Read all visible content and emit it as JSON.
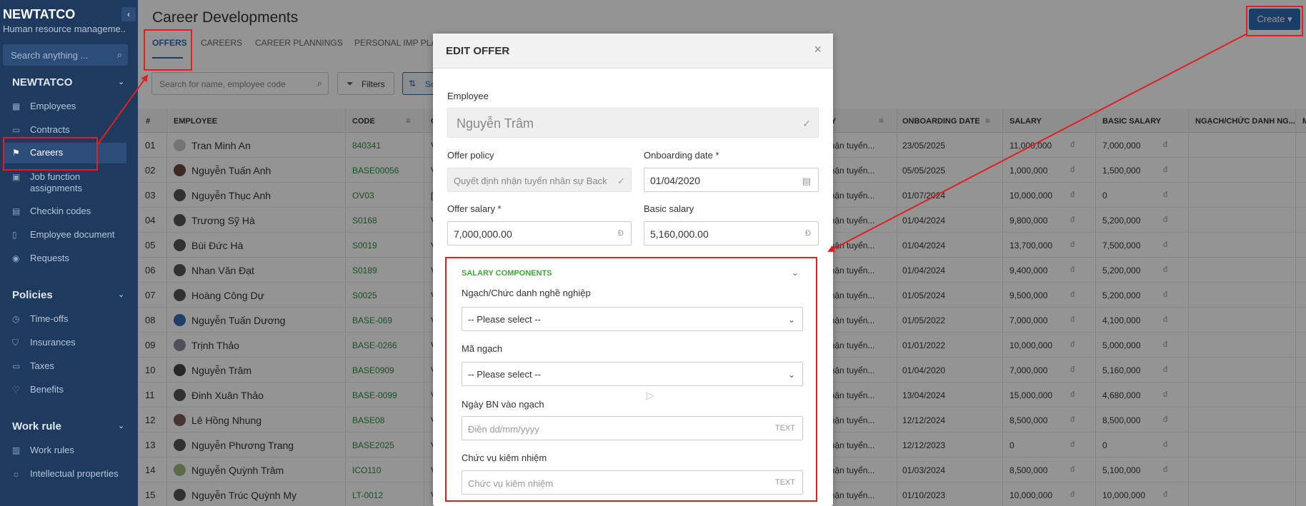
{
  "sidebar": {
    "brand": "NEWTATCO",
    "subtitle": "Human resource manageme...",
    "search_placeholder": "Search anything ...",
    "groups": [
      {
        "label": "NEWTATCO"
      },
      {
        "label": "Policies"
      },
      {
        "label": "Work rule"
      }
    ],
    "items": [
      {
        "label": "Employees",
        "icon": "grid-icon"
      },
      {
        "label": "Contracts",
        "icon": "document-icon"
      },
      {
        "label": "Careers",
        "icon": "flag-icon"
      },
      {
        "label": "Job function assignments",
        "icon": "image-icon"
      },
      {
        "label": "Checkin codes",
        "icon": "calendar-icon"
      },
      {
        "label": "Employee document",
        "icon": "file-icon"
      },
      {
        "label": "Requests",
        "icon": "signal-icon"
      },
      {
        "label": "Time-offs",
        "icon": "clock-icon"
      },
      {
        "label": "Insurances",
        "icon": "shield-icon"
      },
      {
        "label": "Taxes",
        "icon": "money-icon"
      },
      {
        "label": "Benefits",
        "icon": "heart-icon"
      },
      {
        "label": "Work rules",
        "icon": "book-icon"
      },
      {
        "label": "Intellectual properties",
        "icon": "bulb-icon"
      }
    ]
  },
  "header": {
    "title": "Career Developments",
    "create_label": "Create",
    "tabs": [
      "OFFERS",
      "CAREERS",
      "CAREER PLANNINGS",
      "PERSONAL IMP PLA"
    ]
  },
  "toolbar": {
    "search_placeholder": "Search for name, employee code",
    "filters_label": "Filters",
    "sort_label": "So"
  },
  "table": {
    "columns": [
      "#",
      "EMPLOYEE",
      "CODE",
      "C",
      "CY",
      "ONBOARDING DATE",
      "SALARY",
      "BASIC SALARY",
      "NGẠCH/CHỨC DANH NG...",
      "M"
    ],
    "currency": "đ",
    "rows": [
      {
        "num": "01",
        "name": "Tran Minh An",
        "code": "840341",
        "c": "V",
        "policy": "nhận tuyển...",
        "date": "23/05/2025",
        "salary": "11,000,000",
        "basic": "7,000,000"
      },
      {
        "num": "02",
        "name": "Nguyễn Tuấn Anh",
        "code": "BASE00056",
        "c": "V",
        "policy": "nhận tuyển...",
        "date": "05/05/2025",
        "salary": "1,000,000",
        "basic": "1,500,000"
      },
      {
        "num": "03",
        "name": "Nguyễn Thục Anh",
        "code": "OV03",
        "c": "[",
        "policy": "nhận tuyển...",
        "date": "01/07/2024",
        "salary": "10,000,000",
        "basic": "0"
      },
      {
        "num": "04",
        "name": "Trương Sỹ Hà",
        "code": "S0168",
        "c": "V",
        "policy": "nhận tuyển...",
        "date": "01/04/2024",
        "salary": "9,800,000",
        "basic": "5,200,000"
      },
      {
        "num": "05",
        "name": "Bùi Đức Hà",
        "code": "S0019",
        "c": "V",
        "policy": "nhận tuyển...",
        "date": "01/04/2024",
        "salary": "13,700,000",
        "basic": "7,500,000"
      },
      {
        "num": "06",
        "name": "Nhan Văn Đạt",
        "code": "S0189",
        "c": "V",
        "policy": "nhận tuyển...",
        "date": "01/04/2024",
        "salary": "9,400,000",
        "basic": "5,200,000"
      },
      {
        "num": "07",
        "name": "Hoàng Công Dự",
        "code": "S0025",
        "c": "V",
        "policy": "nhận tuyển...",
        "date": "01/05/2024",
        "salary": "9,500,000",
        "basic": "5,200,000"
      },
      {
        "num": "08",
        "name": "Nguyễn Tuấn Dương",
        "code": "BASE-069",
        "c": "V",
        "policy": "nhận tuyển...",
        "date": "01/05/2022",
        "salary": "7,000,000",
        "basic": "4,100,000"
      },
      {
        "num": "09",
        "name": "Trịnh Thảo",
        "code": "BASE-0266",
        "c": "V",
        "policy": "nhận tuyển...",
        "date": "01/01/2022",
        "salary": "10,000,000",
        "basic": "5,000,000"
      },
      {
        "num": "10",
        "name": "Nguyễn Trâm",
        "code": "BASE0909",
        "c": "V",
        "policy": "nhận tuyển...",
        "date": "01/04/2020",
        "salary": "7,000,000",
        "basic": "5,160,000"
      },
      {
        "num": "11",
        "name": "Đinh Xuân Thảo",
        "code": "BASE-0099",
        "c": "V",
        "policy": "nhận tuyển...",
        "date": "13/04/2024",
        "salary": "15,000,000",
        "basic": "4,680,000"
      },
      {
        "num": "12",
        "name": "Lê Hồng Nhung",
        "code": "BASE08",
        "c": "V",
        "policy": "nhận tuyển...",
        "date": "12/12/2024",
        "salary": "8,500,000",
        "basic": "8,500,000"
      },
      {
        "num": "13",
        "name": "Nguyễn Phương Trang",
        "code": "BASE2025",
        "c": "V",
        "policy": "nhận tuyển...",
        "date": "12/12/2023",
        "salary": "0",
        "basic": "0"
      },
      {
        "num": "14",
        "name": "Nguyễn Quỳnh Trâm",
        "code": "ICO110",
        "c": "V",
        "policy": "nhận tuyển...",
        "date": "01/03/2024",
        "salary": "8,500,000",
        "basic": "5,100,000"
      },
      {
        "num": "15",
        "name": "Nguyễn Trúc Quỳnh My",
        "code": "LT-0012",
        "c": "V",
        "policy": "nhận tuyển...",
        "date": "01/10/2023",
        "salary": "10,000,000",
        "basic": "10,000,000"
      }
    ]
  },
  "modal": {
    "title": "EDIT OFFER",
    "employee_label": "Employee",
    "employee_value": "Nguyễn Trâm",
    "offer_policy_label": "Offer policy",
    "offer_policy_value": "Quyết định nhận tuyển nhân sự Back",
    "onboarding_label": "Onboarding date *",
    "onboarding_value": "01/04/2020",
    "offer_salary_label": "Offer salary *",
    "offer_salary_value": "7,000,000.00",
    "basic_salary_label": "Basic salary",
    "basic_salary_value": "5,160,000.00",
    "currency_suffix": "Đ",
    "salary_components_title": "SALARY COMPONENTS",
    "ngach_label": "Ngạch/Chức danh nghề nghiệp",
    "ngach_value": "-- Please select --",
    "ma_ngach_label": "Mã ngạch",
    "ma_ngach_value": "-- Please select --",
    "ngay_label": "Ngày BN vào ngạch",
    "ngay_placeholder": "Điền dd/mm/yyyy",
    "chuc_vu_label": "Chức vụ kiêm nhiệm",
    "chuc_vu_placeholder": "Chức vụ kiêm nhiệm",
    "text_suffix": "TEXT"
  },
  "colors": {
    "sidebar_bg": "#1e3a5f",
    "accent": "#2f6bb5",
    "code_green": "#2e8b3d",
    "section_green": "#3aaa35",
    "annotation_red": "#e02020"
  }
}
